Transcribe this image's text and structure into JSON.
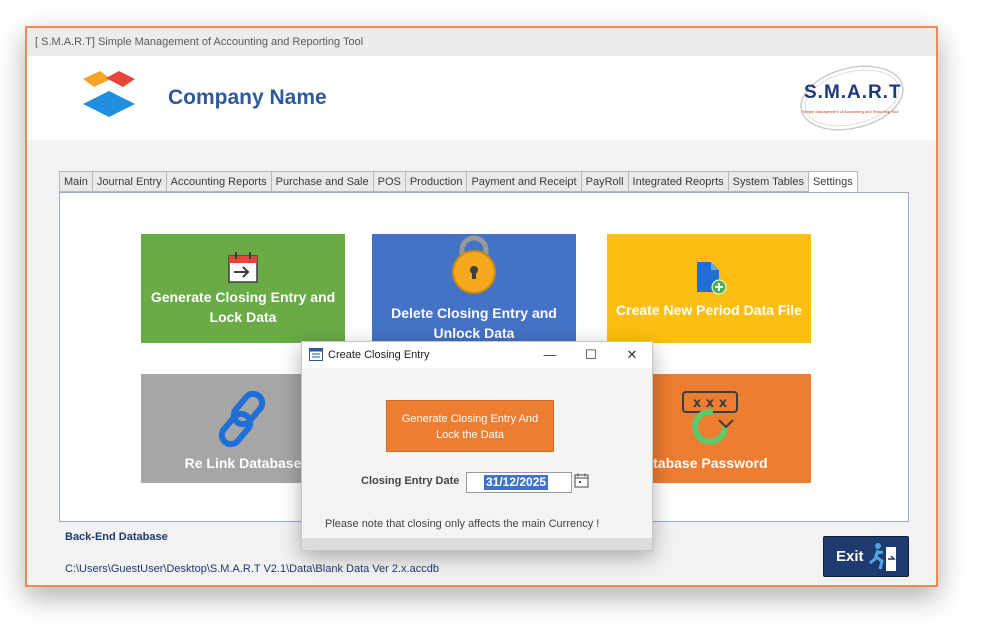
{
  "app": {
    "title": "[ S.M.A.R.T] Simple Management of Accounting and Reporting Tool"
  },
  "header": {
    "company_name": "Company Name",
    "logo_text": "S.M.A.R.T",
    "logo_subtext": "Simple Management of Accounting and Reporting Tool"
  },
  "tabs": [
    {
      "label": "Main"
    },
    {
      "label": "Journal Entry"
    },
    {
      "label": "Accounting Reports"
    },
    {
      "label": "Purchase and Sale"
    },
    {
      "label": "POS"
    },
    {
      "label": "Production"
    },
    {
      "label": "Payment and Receipt"
    },
    {
      "label": "PayRoll"
    },
    {
      "label": "Integrated Reoprts"
    },
    {
      "label": "System Tables"
    },
    {
      "label": "Settings",
      "active": true
    }
  ],
  "tiles": {
    "generate_closing": {
      "line1": "Generate Closing Entry and",
      "line2": "Lock Data"
    },
    "delete_closing": {
      "line1": "Delete Closing Entry and",
      "line2": "Unlock Data"
    },
    "new_period": {
      "label": "Create New Period Data File"
    },
    "relink": {
      "label": "Re Link Database"
    },
    "change_password": {
      "label": "ge Database Password"
    }
  },
  "footer": {
    "backend_label": "Back-End Database",
    "backend_path": "C:\\Users\\GuestUser\\Desktop\\S.M.A.R.T V2.1\\Data\\Blank Data Ver 2.x.accdb",
    "exit_label": "Exit"
  },
  "dialog": {
    "title": "Create Closing Entry",
    "button_line1": "Generate Closing Entry And",
    "button_line2": "Lock the Data",
    "date_label": "Closing Entry Date",
    "date_value": "31/12/2025",
    "note": "Please note that closing only affects the main Currency !",
    "minimize": "—",
    "maximize": "☐",
    "close": "✕"
  },
  "colors": {
    "window_border": "#ee8a55",
    "accent_blue": "#2e5a9a",
    "tile_green": "#6aab46",
    "tile_blue": "#4472c4",
    "tile_yellow": "#fdbf0f",
    "tile_gray": "#a6a6a6",
    "tile_orange": "#ed7d31",
    "exit_navy": "#1f3a6e"
  },
  "icons": {
    "company_logo": "diamond-logo-icon",
    "calendar_arrow": "calendar-arrow-icon",
    "lock": "unlock-padlock-icon",
    "new_file": "document-plus-icon",
    "link": "chain-link-icon",
    "password": "password-refresh-icon",
    "exit": "running-exit-icon",
    "date_picker": "calendar-icon",
    "form": "form-icon"
  }
}
